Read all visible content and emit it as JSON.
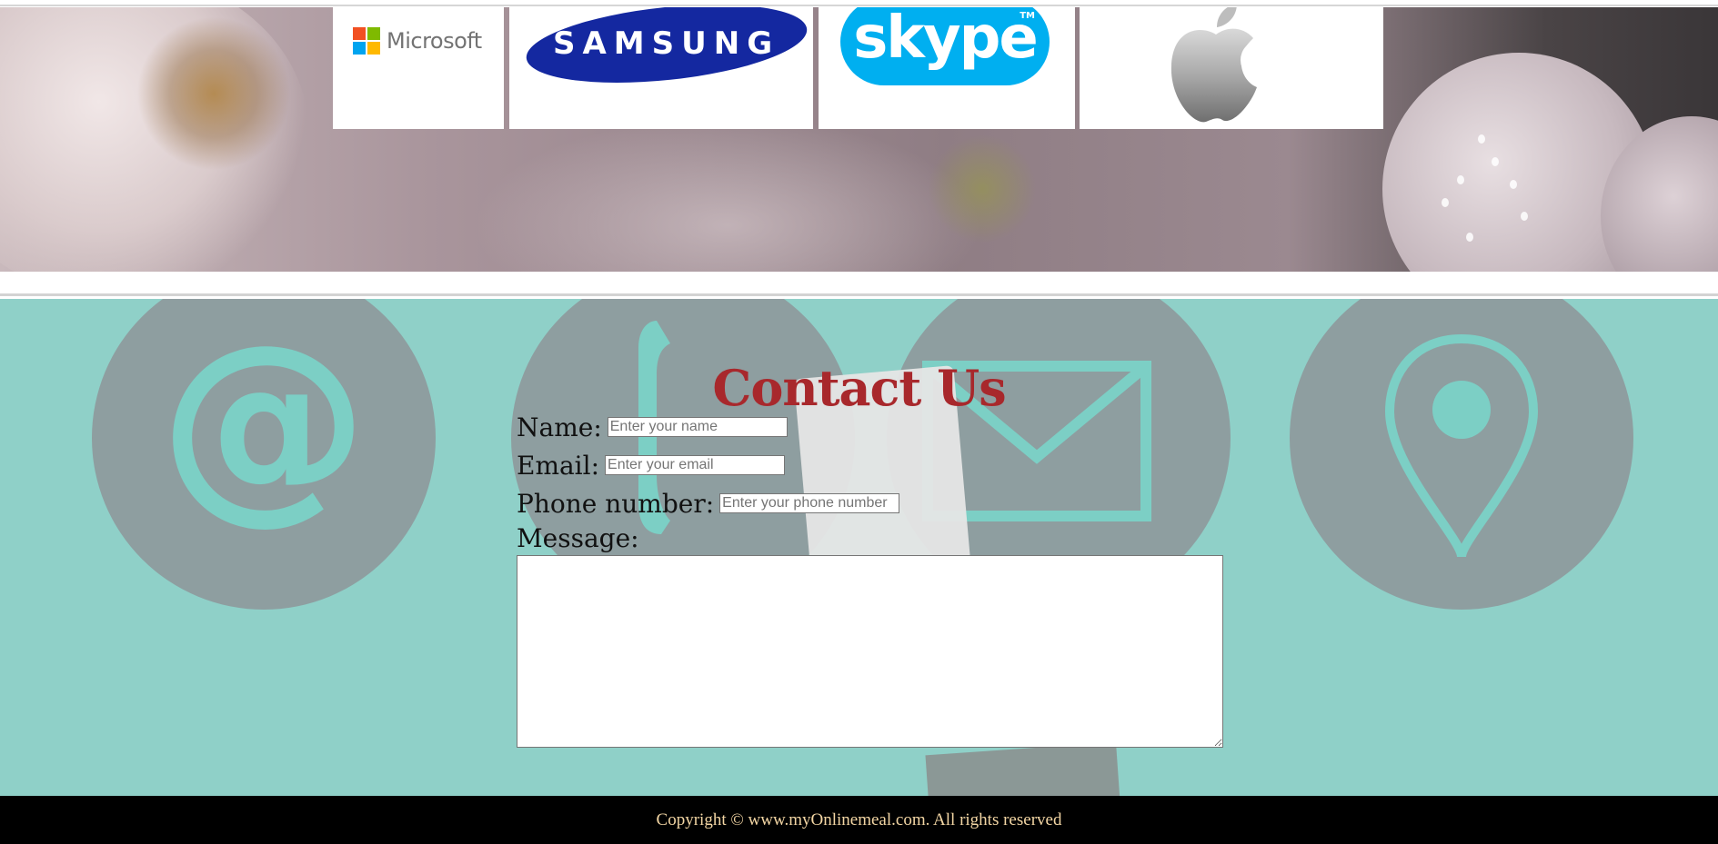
{
  "partners": {
    "microsoft": "Microsoft",
    "samsung": "SAMSUNG",
    "skype": "skype",
    "skype_tm": "TM",
    "apple_icon": "apple-logo"
  },
  "contact": {
    "title": "Contact Us",
    "name_label": "Name:",
    "name_placeholder": "Enter your name",
    "email_label": "Email:",
    "email_placeholder": "Enter your email",
    "phone_label": "Phone number:",
    "phone_placeholder": "Enter your phone number",
    "message_label": "Message:",
    "message_value": ""
  },
  "background_icons": [
    "at-icon",
    "telephone-icon",
    "envelope-icon",
    "location-pin-icon"
  ],
  "footer": {
    "copyright": "Copyright © www.myOnlinemeal.com. All rights reserved"
  },
  "colors": {
    "title": "#a8282c",
    "contact_bg": "#8fd0c8",
    "footer_bg": "#000000",
    "footer_text": "#f3d6a4",
    "samsung_blue": "#1428a0",
    "skype_blue": "#00aff0"
  }
}
